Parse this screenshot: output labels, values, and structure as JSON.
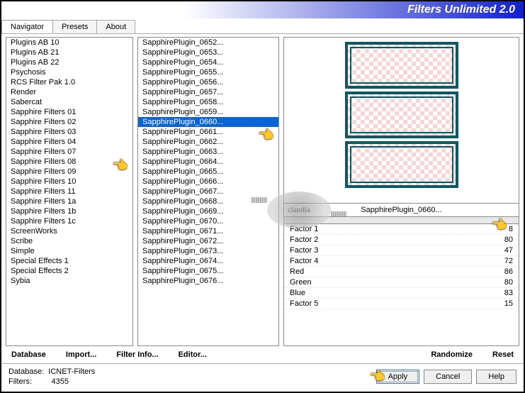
{
  "title": "Filters Unlimited 2.0",
  "tabs": [
    "Navigator",
    "Presets",
    "About"
  ],
  "leftList": [
    "Plugins AB 10",
    "Plugins AB 21",
    "Plugins AB 22",
    "Psychosis",
    "RCS Filter Pak 1.0",
    "Render",
    "Sabercat",
    "Sapphire Filters 01",
    "Sapphire Filters 02",
    "Sapphire Filters 03",
    "Sapphire Filters 04",
    "Sapphire Filters 07",
    "Sapphire Filters 08",
    "Sapphire Filters 09",
    "Sapphire Filters 10",
    "Sapphire Filters 11",
    "Sapphire Filters 1a",
    "Sapphire Filters 1b",
    "Sapphire Filters 1c",
    "ScreenWorks",
    "Scribe",
    "Simple",
    "Special Effects 1",
    "Special Effects 2",
    "Sybia"
  ],
  "midList": [
    "SapphirePlugin_0652...",
    "SapphirePlugin_0653...",
    "SapphirePlugin_0654...",
    "SapphirePlugin_0655...",
    "SapphirePlugin_0656...",
    "SapphirePlugin_0657...",
    "SapphirePlugin_0658...",
    "SapphirePlugin_0659...",
    "SapphirePlugin_0660...",
    "SapphirePlugin_0661...",
    "SapphirePlugin_0662...",
    "SapphirePlugin_0663...",
    "SapphirePlugin_0664...",
    "SapphirePlugin_0665...",
    "SapphirePlugin_0666...",
    "SapphirePlugin_0667...",
    "SapphirePlugin_0668...",
    "SapphirePlugin_0669...",
    "SapphirePlugin_0670...",
    "SapphirePlugin_0671...",
    "SapphirePlugin_0672...",
    "SapphirePlugin_0673...",
    "SapphirePlugin_0674...",
    "SapphirePlugin_0675...",
    "SapphirePlugin_0676..."
  ],
  "midSelectedIndex": 8,
  "previewLabel": "SapphirePlugin_0660...",
  "params": [
    {
      "name": "Factor 1",
      "value": 8
    },
    {
      "name": "Factor 2",
      "value": 80
    },
    {
      "name": "Factor 3",
      "value": 47
    },
    {
      "name": "Factor 4",
      "value": 72
    },
    {
      "name": "Red",
      "value": 86
    },
    {
      "name": "Green",
      "value": 80
    },
    {
      "name": "Blue",
      "value": 83
    },
    {
      "name": "Factor 5",
      "value": 15
    }
  ],
  "bottom": {
    "database": "Database",
    "import": "Import...",
    "filterInfo": "Filter Info...",
    "editor": "Editor...",
    "randomize": "Randomize",
    "reset": "Reset"
  },
  "footer": {
    "dbLabel": "Database:",
    "dbValue": "ICNET-Filters",
    "filtersLabel": "Filters:",
    "filtersValue": "4355"
  },
  "buttons": {
    "apply": "Apply",
    "cancel": "Cancel",
    "help": "Help"
  },
  "watermark": "claudia"
}
